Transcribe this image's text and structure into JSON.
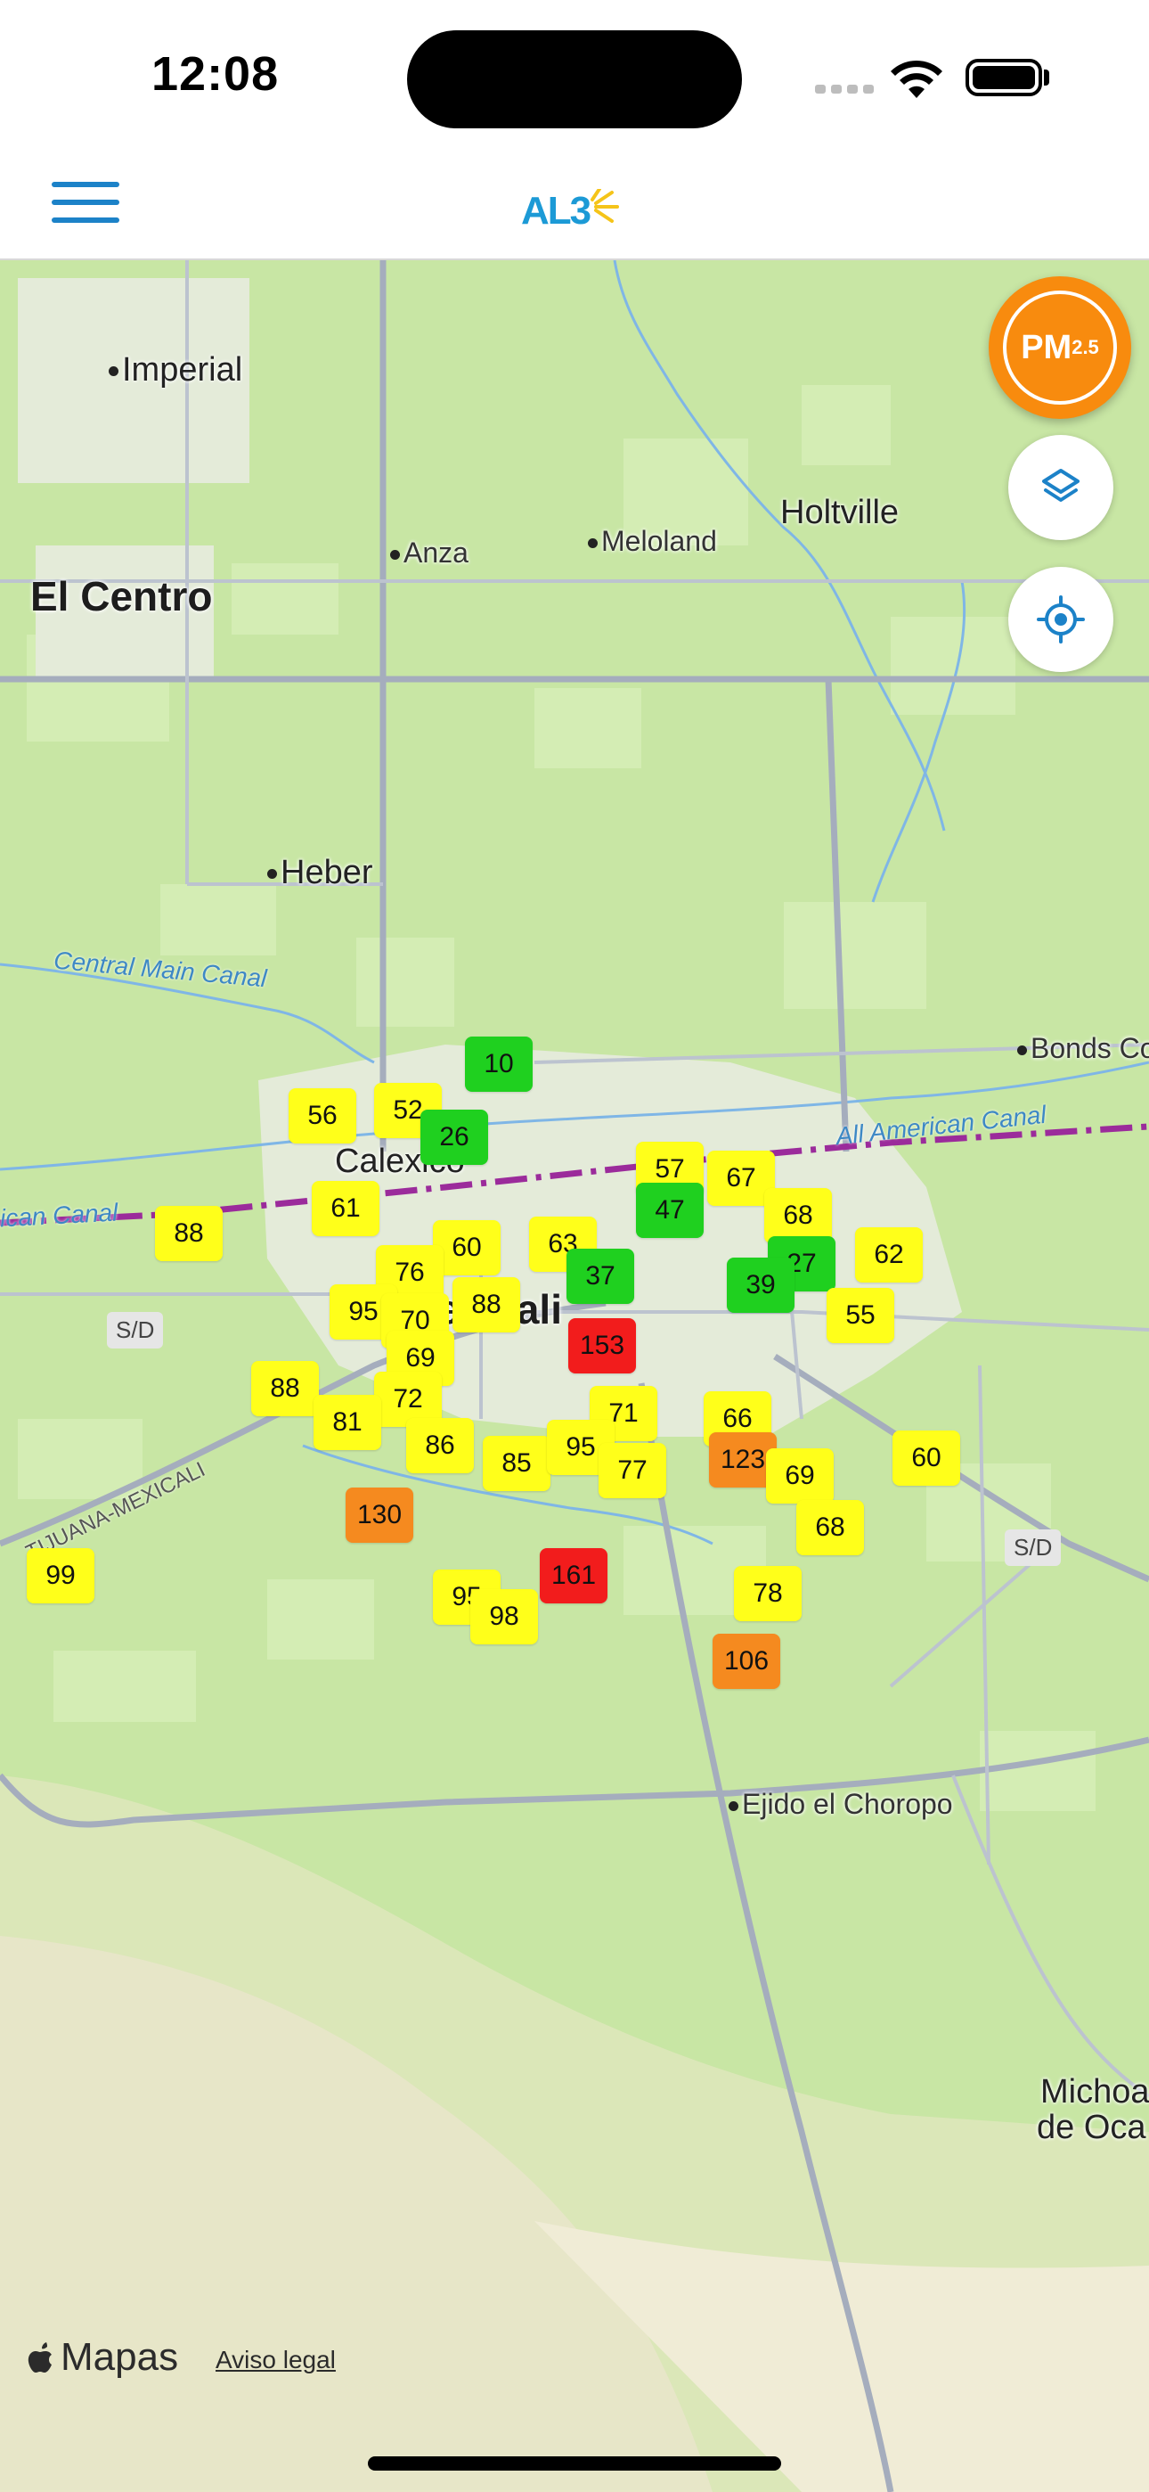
{
  "status_bar": {
    "time": "12:08"
  },
  "header": {
    "logo_text": "AL3",
    "menu_icon": "hamburger-menu-icon"
  },
  "map": {
    "places": [
      {
        "name": "Imperial",
        "size": "md",
        "dot": true
      },
      {
        "name": "El Centro",
        "size": "lg",
        "dot": false
      },
      {
        "name": "Anza",
        "size": "sm",
        "dot": true
      },
      {
        "name": "Meloland",
        "size": "sm",
        "dot": true
      },
      {
        "name": "Holtville",
        "size": "md",
        "dot": false
      },
      {
        "name": "Heber",
        "size": "md",
        "dot": true
      },
      {
        "name": "Bonds Co",
        "size": "sm",
        "dot": true
      },
      {
        "name": "Calexico",
        "size": "md",
        "dot": false
      },
      {
        "name": "Mexicali",
        "size": "lg",
        "dot": false
      },
      {
        "name": "Ejido el Choropo",
        "size": "sm",
        "dot": true
      },
      {
        "name": "Michoa",
        "size": "md",
        "dot": false
      },
      {
        "name": "de Oca",
        "size": "md",
        "dot": false
      }
    ],
    "water_labels": [
      "Central Main Canal",
      "All American Canal",
      "ican Canal"
    ],
    "road_labels": [
      "TIJUANA-MEXICALI"
    ],
    "no_data_labels": [
      "S/D",
      "S/D"
    ],
    "markers": [
      {
        "value": "10",
        "level": "good"
      },
      {
        "value": "56",
        "level": "moderate"
      },
      {
        "value": "52",
        "level": "moderate"
      },
      {
        "value": "26",
        "level": "good"
      },
      {
        "value": "61",
        "level": "moderate"
      },
      {
        "value": "88",
        "level": "moderate"
      },
      {
        "value": "57",
        "level": "moderate"
      },
      {
        "value": "67",
        "level": "moderate"
      },
      {
        "value": "47",
        "level": "good"
      },
      {
        "value": "68",
        "level": "moderate"
      },
      {
        "value": "27",
        "level": "good"
      },
      {
        "value": "62",
        "level": "moderate"
      },
      {
        "value": "60",
        "level": "moderate"
      },
      {
        "value": "63",
        "level": "moderate"
      },
      {
        "value": "76",
        "level": "moderate"
      },
      {
        "value": "37",
        "level": "good"
      },
      {
        "value": "39",
        "level": "good"
      },
      {
        "value": "55",
        "level": "moderate"
      },
      {
        "value": "95",
        "level": "moderate"
      },
      {
        "value": "70",
        "level": "moderate"
      },
      {
        "value": "88",
        "level": "moderate"
      },
      {
        "value": "153",
        "level": "unhealthy"
      },
      {
        "value": "69",
        "level": "moderate"
      },
      {
        "value": "88",
        "level": "moderate"
      },
      {
        "value": "72",
        "level": "moderate"
      },
      {
        "value": "81",
        "level": "moderate"
      },
      {
        "value": "71",
        "level": "moderate"
      },
      {
        "value": "66",
        "level": "moderate"
      },
      {
        "value": "86",
        "level": "moderate"
      },
      {
        "value": "85",
        "level": "moderate"
      },
      {
        "value": "95",
        "level": "moderate"
      },
      {
        "value": "77",
        "level": "moderate"
      },
      {
        "value": "123",
        "level": "sensitive"
      },
      {
        "value": "69",
        "level": "moderate"
      },
      {
        "value": "60",
        "level": "moderate"
      },
      {
        "value": "130",
        "level": "sensitive"
      },
      {
        "value": "68",
        "level": "moderate"
      },
      {
        "value": "99",
        "level": "moderate"
      },
      {
        "value": "161",
        "level": "unhealthy"
      },
      {
        "value": "95",
        "level": "moderate"
      },
      {
        "value": "98",
        "level": "moderate"
      },
      {
        "value": "78",
        "level": "moderate"
      },
      {
        "value": "106",
        "level": "sensitive"
      }
    ],
    "level_colors": {
      "good": "#1fd01f",
      "moderate": "#ffff1a",
      "sensitive": "#f58a1f",
      "unhealthy": "#f21c1c"
    }
  },
  "controls": {
    "pollutant_button": "PM",
    "pollutant_sub": "2.5",
    "layers_icon": "layers-icon",
    "locate_icon": "locate-icon"
  },
  "attribution": {
    "brand": "Mapas",
    "legal": "Aviso legal"
  },
  "colors": {
    "accent": "#1c82c8",
    "pm_button": "#f88b0e",
    "map_land": "#c8e6a4"
  }
}
